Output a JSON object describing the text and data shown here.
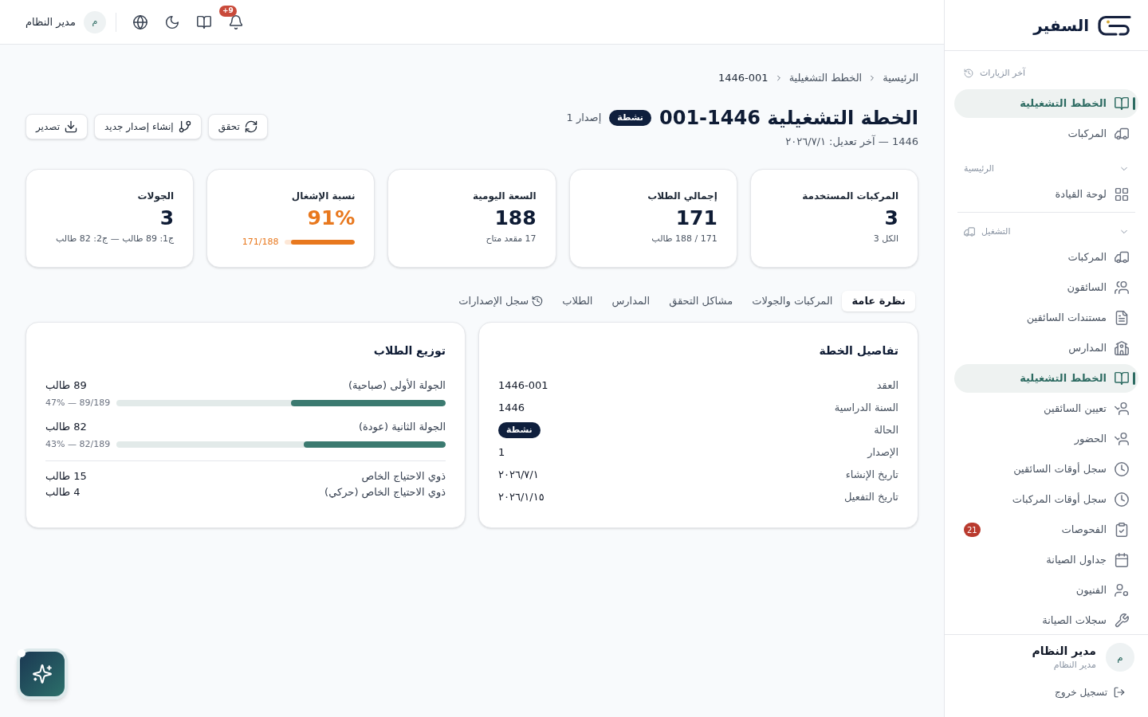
{
  "sidebar": {
    "brand": "السفير",
    "recent": {
      "title": "آخر الزيارات",
      "items": [
        {
          "label": "الخطط التشغيلية",
          "selected": true
        },
        {
          "label": "المركبات",
          "selected": false
        }
      ]
    },
    "groups": [
      {
        "title": "الرئيسية",
        "expanded": true,
        "items": [
          {
            "label": "لوحة القيادة",
            "selected": false
          }
        ]
      },
      {
        "title": "التشغيل",
        "expanded": true,
        "items": [
          {
            "label": "المركبات",
            "selected": false
          },
          {
            "label": "السائقون",
            "selected": false
          },
          {
            "label": "مستندات السائقين",
            "selected": false
          },
          {
            "label": "المدارس",
            "selected": false
          },
          {
            "label": "الخطط التشغيلية",
            "selected": true
          },
          {
            "label": "تعيين السائقين",
            "selected": false
          },
          {
            "label": "الحضور",
            "selected": false
          },
          {
            "label": "سجل أوقات السائقين",
            "selected": false
          },
          {
            "label": "سجل أوقات المركبات",
            "selected": false
          },
          {
            "label": "الفحوصات",
            "selected": false,
            "badge": "21"
          },
          {
            "label": "جداول الصيانة",
            "selected": false
          },
          {
            "label": "الفنيون",
            "selected": false
          },
          {
            "label": "سجلات الصيانة",
            "selected": false
          }
        ]
      }
    ],
    "user": {
      "avatar": "م",
      "name": "مدير النظام",
      "role": "مدير النظام"
    },
    "logout": "تسجيل خروج"
  },
  "topbar": {
    "notification_badge": "+9",
    "user": {
      "avatar": "م",
      "name": "مدير النظام"
    }
  },
  "breadcrumb": [
    "الرئيسية",
    "الخطط التشغيلية",
    "1446-001"
  ],
  "page_header": {
    "title": "الخطة التشغيلية 1446-001",
    "status": "نشطة",
    "version": "إصدار 1",
    "subtitle": "1446 — آخر تعديل: ٢٠٢٦/٧/١",
    "actions": [
      "تحقق",
      "إنشاء إصدار جديد",
      "تصدير"
    ]
  },
  "stats": [
    {
      "kind": "plain",
      "label": "المركبات المستخدمة",
      "value": "3",
      "note": "الكل 3"
    },
    {
      "kind": "plain",
      "label": "إجمالي الطلاب",
      "value": "171",
      "note": "171 / 188 طالب"
    },
    {
      "kind": "plain",
      "label": "السعة اليومية",
      "value": "188",
      "note": "17 مقعد متاح"
    },
    {
      "kind": "progress",
      "label": "نسبة الإشغال",
      "value": "91%",
      "level": 0.91,
      "note": "171/188"
    },
    {
      "kind": "plain",
      "label": "الجولات",
      "value": "3",
      "note": "ج1: 89 طالب — ج2: 82 طالب"
    }
  ],
  "tabs": [
    {
      "label": "نظرة عامة",
      "selected": true
    },
    {
      "label": "المركبات والجولات",
      "selected": false
    },
    {
      "label": "مشاكل التحقق",
      "selected": false
    },
    {
      "label": "المدارس",
      "selected": false
    },
    {
      "label": "الطلاب",
      "selected": false
    },
    {
      "label": "سجل الإصدارات",
      "selected": false
    }
  ],
  "plan_details": {
    "title": "تفاصيل الخطة",
    "rows": [
      {
        "kind": "text",
        "label": "العقد",
        "value": "1446-001"
      },
      {
        "kind": "text",
        "label": "السنة الدراسية",
        "value": "1446"
      },
      {
        "kind": "badge",
        "label": "الحالة",
        "value": "نشطة"
      },
      {
        "kind": "text",
        "label": "الإصدار",
        "value": "1"
      },
      {
        "kind": "text",
        "label": "تاريخ الإنشاء",
        "value": "٢٠٢٦/٧/١"
      },
      {
        "kind": "text",
        "label": "تاريخ التفعيل",
        "value": "٢٠٢٦/١/١٥"
      }
    ]
  },
  "student_distribution": {
    "title": "توزيع الطلاب",
    "rounds": [
      {
        "label": "الجولة الأولى (صباحية)",
        "count": "89 طالب",
        "level": 0.47,
        "ratio": "89/189 — 47%"
      },
      {
        "label": "الجولة الثانية (عودة)",
        "count": "82 طالب",
        "level": 0.43,
        "ratio": "82/189 — 43%"
      }
    ],
    "special_needs": [
      {
        "label": "ذوي الاحتياج الخاص",
        "count": "15 طالب"
      },
      {
        "label": "ذوي الاحتياج الخاص (حركي)",
        "count": "4 طالب"
      }
    ]
  }
}
